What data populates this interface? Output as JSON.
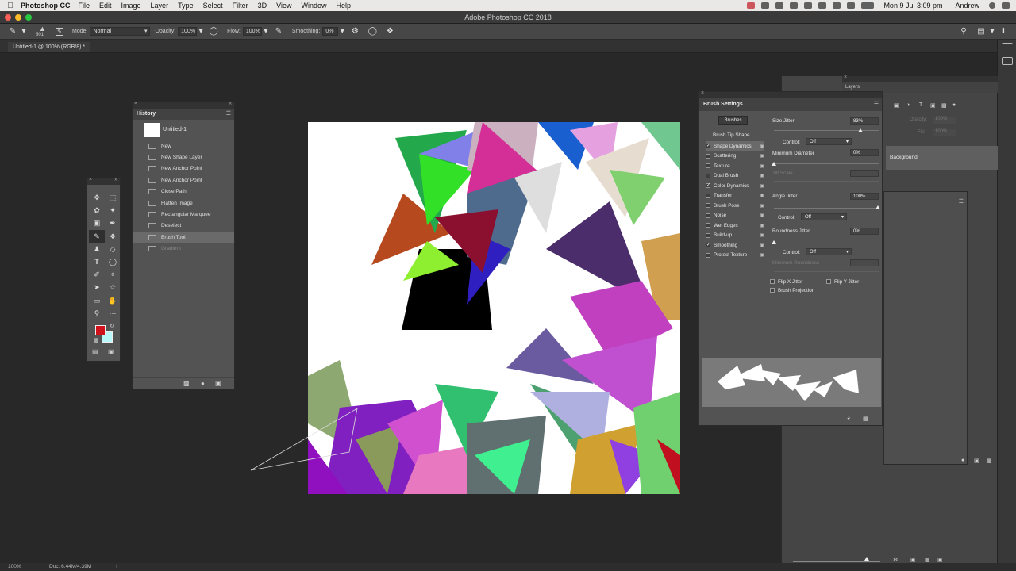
{
  "menubar": {
    "app_name": "Photoshop CC",
    "items": [
      "File",
      "Edit",
      "Image",
      "Layer",
      "Type",
      "Select",
      "Filter",
      "3D",
      "View",
      "Window",
      "Help"
    ],
    "datetime": "Mon 9 Jul  3:09 pm",
    "user": "Andrew"
  },
  "window": {
    "title": "Adobe Photoshop CC 2018"
  },
  "options": {
    "brush_size": "501",
    "mode_label": "Mode:",
    "mode_value": "Normal",
    "opacity_label": "Opacity:",
    "opacity_value": "100%",
    "flow_label": "Flow:",
    "flow_value": "100%",
    "smoothing_label": "Smoothing:",
    "smoothing_value": "0%"
  },
  "document": {
    "tab_title": "Untitled-1 @ 100% (RGB/8) *"
  },
  "history": {
    "title": "History",
    "snapshot": "Untitled-1",
    "items": [
      "New",
      "New Shape Layer",
      "New Anchor Point",
      "New Anchor Point",
      "Close Path",
      "Flatten Image",
      "Rectangular Marquee",
      "Deselect",
      "Brush Tool",
      "Gradient"
    ],
    "selected_index": 8
  },
  "brush_settings": {
    "title": "Brush Settings",
    "brushes_button": "Brushes",
    "tip_shape": "Brush Tip Shape",
    "options": [
      {
        "label": "Shape Dynamics",
        "checked": true
      },
      {
        "label": "Scattering",
        "checked": false
      },
      {
        "label": "Texture",
        "checked": false
      },
      {
        "label": "Dual Brush",
        "checked": false
      },
      {
        "label": "Color Dynamics",
        "checked": true
      },
      {
        "label": "Transfer",
        "checked": false
      },
      {
        "label": "Brush Pose",
        "checked": false
      },
      {
        "label": "Noise",
        "checked": false
      },
      {
        "label": "Wet Edges",
        "checked": false
      },
      {
        "label": "Build-up",
        "checked": false
      },
      {
        "label": "Smoothing",
        "checked": true
      },
      {
        "label": "Protect Texture",
        "checked": false
      }
    ],
    "size_jitter_label": "Size Jitter",
    "size_jitter_value": "83%",
    "size_jitter_level": 0.83,
    "control_label": "Control:",
    "control_value": "Off",
    "min_diameter_label": "Minimum Diameter",
    "min_diameter_value": "0%",
    "tilt_scale_label": "Tilt Scale",
    "angle_jitter_label": "Angle Jitter",
    "angle_jitter_value": "100%",
    "roundness_jitter_label": "Roundness Jitter",
    "roundness_jitter_value": "0%",
    "min_roundness_label": "Minimum Roundness",
    "flip_x": "Flip X Jitter",
    "flip_y": "Flip Y Jitter",
    "brush_projection": "Brush Projection"
  },
  "layers": {
    "background_layer": "Background",
    "opacity_label": "Opacity:",
    "opacity_value": "100%",
    "fill_label": "Fill:",
    "fill_value": "100%",
    "panel_title": "Layers"
  },
  "status": {
    "zoom": "100%",
    "doc": "Doc: 6.44M/4.39M"
  },
  "colors": {
    "foreground": "#d0121c",
    "background": "#b8f7fa"
  }
}
